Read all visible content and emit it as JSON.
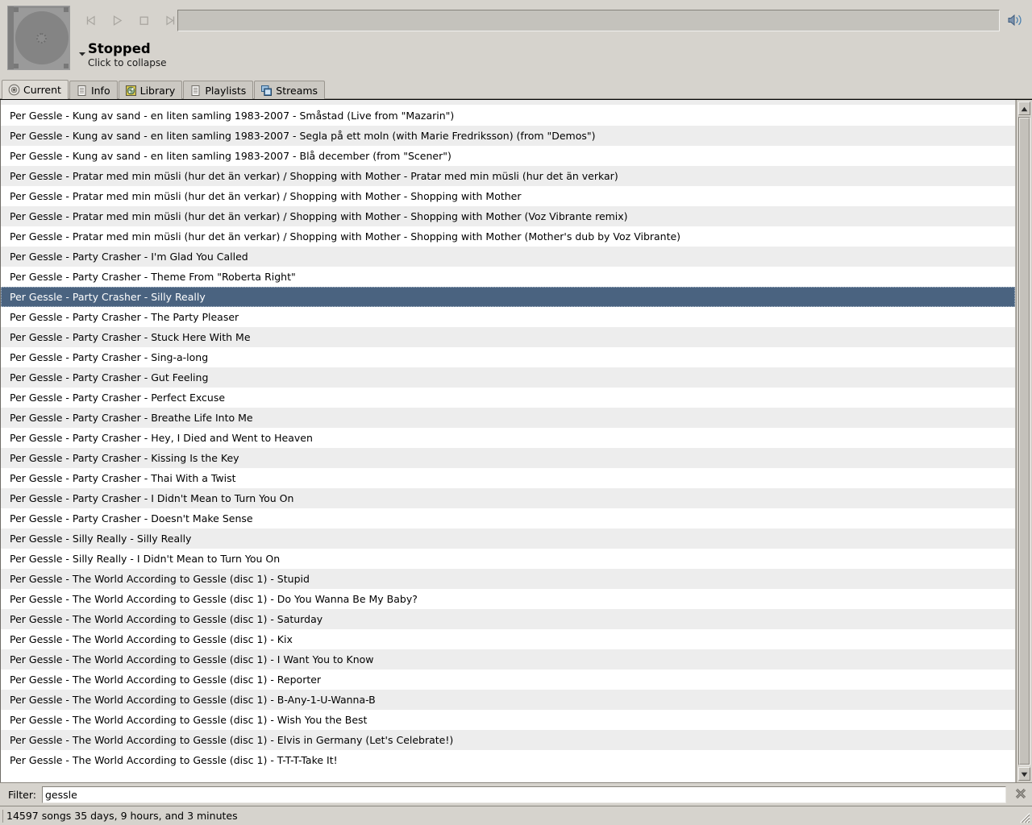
{
  "player": {
    "album_art_icon": "cd-jewelcase-placeholder",
    "controls": [
      {
        "name": "previous-track-button",
        "icon": "skip-previous-icon",
        "label": "Previous"
      },
      {
        "name": "play-button",
        "icon": "play-icon",
        "label": "Play"
      },
      {
        "name": "stop-button",
        "icon": "stop-icon",
        "label": "Stop"
      },
      {
        "name": "next-track-button",
        "icon": "skip-next-icon",
        "label": "Next"
      }
    ],
    "seek_value": "",
    "volume_icon": "volume-speaker-icon",
    "collapse_icon": "chevron-down-icon",
    "status": "Stopped",
    "collapse_hint": "Click to collapse"
  },
  "tabs": [
    {
      "label": "Current",
      "icon": "disc-icon",
      "active": true
    },
    {
      "label": "Info",
      "icon": "document-icon",
      "active": false
    },
    {
      "label": "Library",
      "icon": "library-icon",
      "active": false
    },
    {
      "label": "Playlists",
      "icon": "document-icon",
      "active": false
    },
    {
      "label": "Streams",
      "icon": "windows-icon",
      "active": false
    }
  ],
  "list": {
    "selected_index": 9,
    "has_clipped_top_row": true,
    "rows": [
      "Per Gessle - Kung av sand - en liten samling 1983-2007 - Småstad (Live from \"Mazarin\")",
      "Per Gessle - Kung av sand - en liten samling 1983-2007 - Segla på ett moln (with Marie Fredriksson) (from \"Demos\")",
      "Per Gessle - Kung av sand - en liten samling 1983-2007 - Blå december (from \"Scener\")",
      "Per Gessle - Pratar med min müsli (hur det än verkar) / Shopping with Mother - Pratar med min müsli (hur det än verkar)",
      "Per Gessle - Pratar med min müsli (hur det än verkar) / Shopping with Mother - Shopping with Mother",
      "Per Gessle - Pratar med min müsli (hur det än verkar) / Shopping with Mother - Shopping with Mother (Voz Vibrante remix)",
      "Per Gessle - Pratar med min müsli (hur det än verkar) / Shopping with Mother - Shopping with Mother (Mother's dub by Voz Vibrante)",
      "Per Gessle - Party Crasher - I'm Glad You Called",
      "Per Gessle - Party Crasher - Theme From \"Roberta Right\"",
      "Per Gessle - Party Crasher - Silly Really",
      "Per Gessle - Party Crasher - The Party Pleaser",
      "Per Gessle - Party Crasher - Stuck Here With Me",
      "Per Gessle - Party Crasher - Sing-a-long",
      "Per Gessle - Party Crasher - Gut Feeling",
      "Per Gessle - Party Crasher - Perfect Excuse",
      "Per Gessle - Party Crasher - Breathe Life Into Me",
      "Per Gessle - Party Crasher - Hey, I Died and Went to Heaven",
      "Per Gessle - Party Crasher - Kissing Is the Key",
      "Per Gessle - Party Crasher - Thai With a Twist",
      "Per Gessle - Party Crasher - I Didn't Mean to Turn You On",
      "Per Gessle - Party Crasher - Doesn't Make Sense",
      "Per Gessle - Silly Really - Silly Really",
      "Per Gessle - Silly Really - I Didn't Mean to Turn You On",
      "Per Gessle - The World According to Gessle (disc 1) - Stupid",
      "Per Gessle - The World According to Gessle (disc 1) - Do You Wanna Be My Baby?",
      "Per Gessle - The World According to Gessle (disc 1) - Saturday",
      "Per Gessle - The World According to Gessle (disc 1) - Kix",
      "Per Gessle - The World According to Gessle (disc 1) - I Want You to Know",
      "Per Gessle - The World According to Gessle (disc 1) - Reporter",
      "Per Gessle - The World According to Gessle (disc 1) - B-Any-1-U-Wanna-B",
      "Per Gessle - The World According to Gessle (disc 1) - Wish You the Best",
      "Per Gessle - The World According to Gessle (disc 1) - Elvis in Germany (Let's Celebrate!)",
      "Per Gessle - The World According to Gessle (disc 1) - T-T-T-Take It!"
    ]
  },
  "scrollbar": {
    "up_icon": "triangle-up-icon",
    "down_icon": "triangle-down-icon"
  },
  "filter": {
    "label": "Filter:",
    "value": "gessle",
    "placeholder": "",
    "clear_icon": "clear-x-icon"
  },
  "statusbar": {
    "text": "14597 songs   35 days, 9 hours, and 3 minutes",
    "grip_icon": "resize-grip-icon"
  },
  "colors": {
    "window_bg": "#d6d3cd",
    "row_bg": "#ffffff",
    "row_alt_bg": "#ededed",
    "selection_bg": "#4a6380",
    "selection_fg": "#ffffff",
    "accent_blue": "#4a80b0"
  }
}
